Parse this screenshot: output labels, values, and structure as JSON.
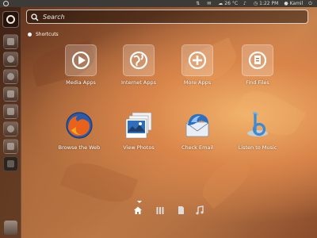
{
  "top_panel": {
    "temperature": "26 °C",
    "time": "1:22 PM",
    "user": "Kamil",
    "icons": [
      "network-icon",
      "mail-icon",
      "volume-icon",
      "clock-icon",
      "user-icon",
      "power-icon"
    ]
  },
  "search": {
    "placeholder": "Search",
    "value": ""
  },
  "section": {
    "title": "Shortcuts"
  },
  "shortcuts_row1": [
    {
      "label": "Media Apps",
      "icon": "media-apps-icon"
    },
    {
      "label": "Internet Apps",
      "icon": "internet-apps-icon"
    },
    {
      "label": "More Apps",
      "icon": "more-apps-icon"
    },
    {
      "label": "Find Files",
      "icon": "find-files-icon"
    }
  ],
  "shortcuts_row2": [
    {
      "label": "Browse the Web",
      "icon": "firefox-icon"
    },
    {
      "label": "View Photos",
      "icon": "photos-icon"
    },
    {
      "label": "Check Email",
      "icon": "thunderbird-icon"
    },
    {
      "label": "Listen to Music",
      "icon": "banshee-icon"
    }
  ],
  "launcher": {
    "icons": [
      "dash-icon",
      "files-icon",
      "disk-icon",
      "sound-icon",
      "mail-app-icon",
      "updates-icon",
      "download-icon",
      "terminal-icon",
      "trash-icon"
    ]
  },
  "lenses": [
    "home-lens-icon",
    "apps-lens-icon",
    "files-lens-icon",
    "music-lens-icon"
  ],
  "colors": {
    "panel": "#3c3b37",
    "text": "#ffffff",
    "wallpaper_accent": "#d9854a"
  }
}
